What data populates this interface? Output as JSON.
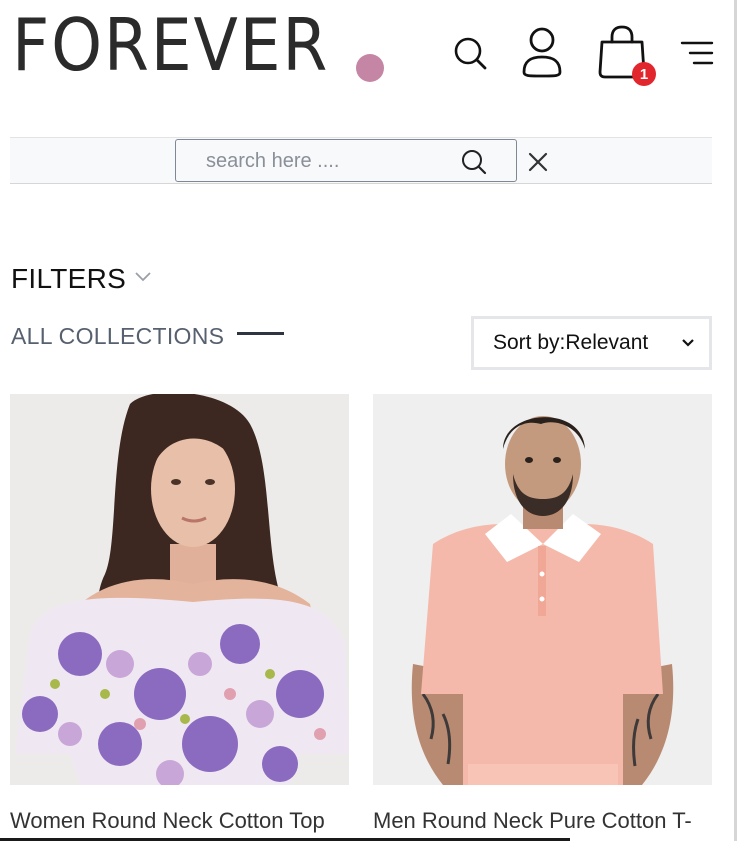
{
  "brand": {
    "name": "FOREVER",
    "dot_color": "#c586a5"
  },
  "header": {
    "icons": [
      "search-icon",
      "user-icon",
      "shopping-bag-icon",
      "menu-icon"
    ],
    "cart_count": "1",
    "badge_color": "#e2262d"
  },
  "search": {
    "placeholder": "search here ....",
    "value": ""
  },
  "filters": {
    "label": "FILTERS"
  },
  "collection": {
    "title": "ALL COLLECTIONS"
  },
  "sort": {
    "selected": "Sort by:Relevant"
  },
  "products": [
    {
      "name": "Women Round Neck Cotton Top"
    },
    {
      "name": "Men Round Neck Pure Cotton T-"
    }
  ]
}
